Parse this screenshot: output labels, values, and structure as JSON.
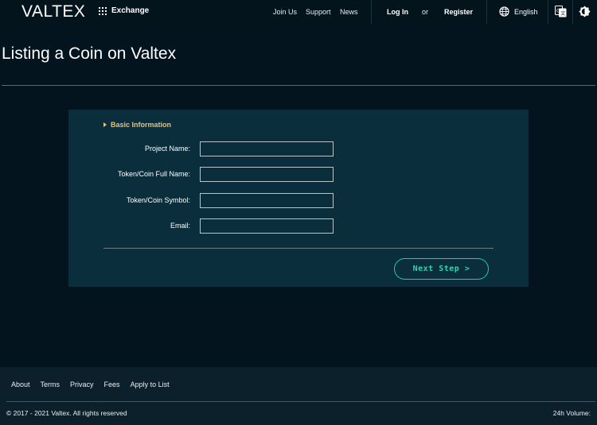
{
  "header": {
    "logo": "VALTEX",
    "exchange_label": "Exchange",
    "nav": {
      "join_us": "Join Us",
      "support": "Support",
      "news": "News",
      "login": "Log In",
      "or": "or",
      "register": "Register",
      "language": "English"
    }
  },
  "page": {
    "title": "Listing a Coin on Valtex"
  },
  "form": {
    "section_title": "Basic Information",
    "fields": [
      {
        "label": "Project Name:",
        "value": "",
        "placeholder": ""
      },
      {
        "label": "Token/Coin Full Name:",
        "value": "",
        "placeholder": ""
      },
      {
        "label": "Token/Coin Symbol:",
        "value": "",
        "placeholder": ""
      },
      {
        "label": "Email:",
        "value": "",
        "placeholder": ""
      }
    ],
    "next_button": "Next Step >"
  },
  "footer": {
    "links": [
      "About",
      "Terms",
      "Privacy",
      "Fees",
      "Apply to List"
    ],
    "copyright": "© 2017 - 2021 Valtex. All rights reserved",
    "volume_label": "24h Volume:"
  },
  "colors": {
    "background": "#03141e",
    "card": "#0b2e3d",
    "accent_gold": "#e8c07a",
    "accent_teal": "#2fd2b8",
    "footer": "#0b202b"
  }
}
